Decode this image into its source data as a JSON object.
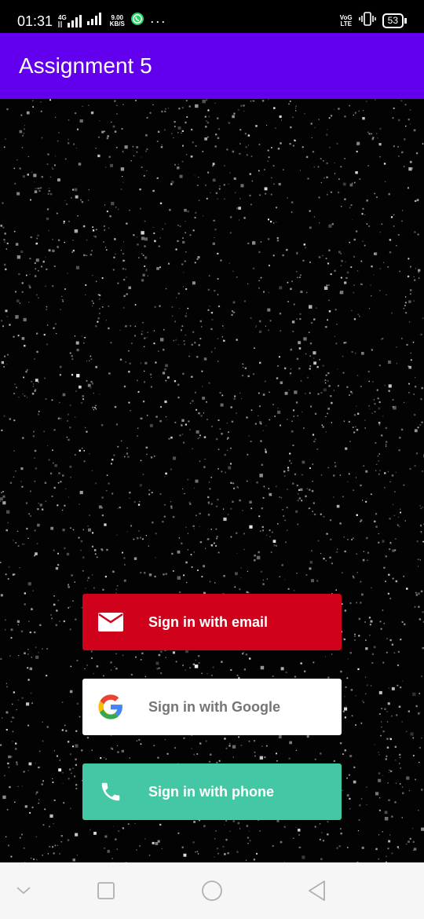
{
  "status_bar": {
    "time": "01:31",
    "network_badge": "4G",
    "speed_value": "9.00",
    "speed_unit": "KB/S",
    "volte_top": "VoG",
    "volte_bottom": "LTE",
    "battery_level": "53",
    "more_indicator": "···",
    "icons": [
      "signal-icon",
      "whatsapp-icon",
      "vibrate-icon",
      "battery-icon"
    ]
  },
  "app_bar": {
    "title": "Assignment 5",
    "color": "#6200ee"
  },
  "sign_in": {
    "email": {
      "label": "Sign in with email",
      "icon": "email-icon",
      "color": "#d0021b"
    },
    "google": {
      "label": "Sign in with Google",
      "icon": "google-icon",
      "color": "#ffffff"
    },
    "phone": {
      "label": "Sign in with phone",
      "icon": "phone-icon",
      "color": "#44c7a4"
    }
  },
  "nav_bar": {
    "icons": [
      "chevron-down-icon",
      "recents-icon",
      "home-icon",
      "back-icon"
    ]
  }
}
